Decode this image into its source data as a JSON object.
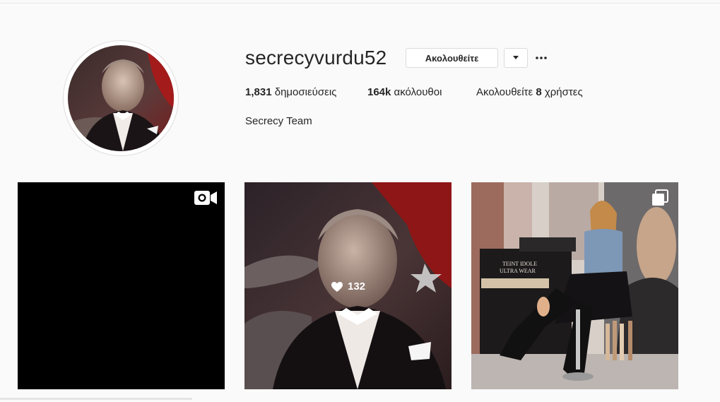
{
  "profile": {
    "username": "secrecyvurdu52",
    "follow_label": "Ακολουθείτε",
    "bio": "Secrecy Team",
    "stats": {
      "posts_value": "1,831",
      "posts_label": "δημοσιεύσεις",
      "followers_value": "164k",
      "followers_label": "ακόλουθοι",
      "following_prefix": "Ακολουθείτε",
      "following_value": "8",
      "following_suffix": "χρήστες"
    }
  },
  "posts": [
    {
      "type": "video",
      "icon": "video-camera-icon"
    },
    {
      "type": "photo",
      "likes": "132",
      "icon": "heart-icon"
    },
    {
      "type": "gallery",
      "icon": "multiple-images-icon",
      "poster_text": "TEINT IDOLE ULTRA WEAR"
    }
  ],
  "colors": {
    "background": "#fafafa",
    "text": "#262626",
    "border": "#dbdbdb"
  }
}
